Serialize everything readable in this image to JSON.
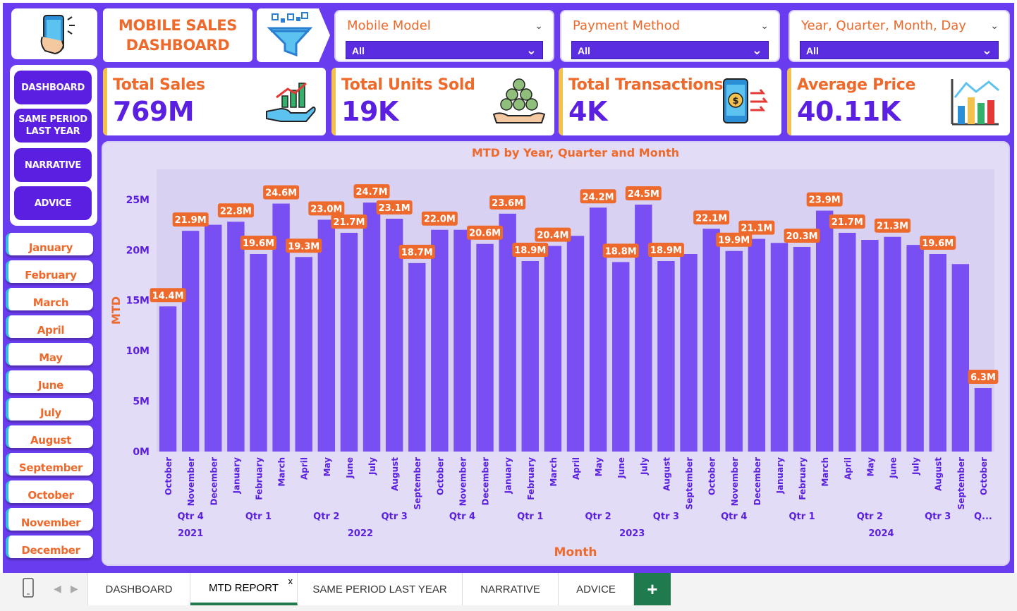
{
  "title": "MOBILE SALES DASHBOARD",
  "title_line1": "MOBILE SALES",
  "title_line2": "DASHBOARD",
  "slicers": [
    {
      "label": "Mobile Model",
      "value": "All"
    },
    {
      "label": "Payment Method",
      "value": "All"
    },
    {
      "label": "Year, Quarter, Month, Day",
      "value": "All"
    }
  ],
  "kpis": [
    {
      "label": "Total Sales",
      "value": "769M",
      "icon": "money-growth-icon"
    },
    {
      "label": "Total Units Sold",
      "value": "19K",
      "icon": "coins-stack-icon"
    },
    {
      "label": "Total Transactions",
      "value": "4K",
      "icon": "phone-payment-icon"
    },
    {
      "label": "Average Price",
      "value": "40.11K",
      "icon": "bar-chart-icon"
    }
  ],
  "nav": {
    "dashboard": "DASHBOARD",
    "same_period_1": "SAME PERIOD",
    "same_period_2": "LAST YEAR",
    "narrative": "NARRATIVE",
    "advice": "ADVICE"
  },
  "months": [
    "January",
    "February",
    "March",
    "April",
    "May",
    "June",
    "July",
    "August",
    "September",
    "October",
    "November",
    "December"
  ],
  "tabs": {
    "dashboard": "DASHBOARD",
    "mtd": "MTD REPORT",
    "mtd_close": "x",
    "same_period": "SAME PERIOD LAST YEAR",
    "narrative": "NARRATIVE",
    "advice": "ADVICE",
    "add": "+"
  },
  "colors": {
    "accent": "#6a3cf0",
    "orange": "#ee6a2c",
    "bar": "#6b3cf2",
    "kpi_value": "#5a1fe0"
  },
  "chart_data": {
    "type": "bar",
    "title": "MTD by Year, Quarter and Month",
    "xlabel": "Month",
    "ylabel": "MTD",
    "ylim": [
      0,
      28
    ],
    "y_unit": "M",
    "yticks": [
      "0M",
      "5M",
      "10M",
      "15M",
      "20M",
      "25M"
    ],
    "categories": [
      "October",
      "November",
      "December",
      "January",
      "February",
      "March",
      "April",
      "May",
      "June",
      "July",
      "August",
      "September",
      "October",
      "November",
      "December",
      "January",
      "February",
      "March",
      "April",
      "May",
      "June",
      "July",
      "August",
      "September",
      "October",
      "November",
      "December",
      "January",
      "February",
      "March",
      "April",
      "May",
      "June",
      "July",
      "August",
      "September",
      "October"
    ],
    "values": [
      14.4,
      21.9,
      22.5,
      22.8,
      19.6,
      24.6,
      19.3,
      23.0,
      21.7,
      24.7,
      23.1,
      18.7,
      22.0,
      22.0,
      20.6,
      23.6,
      18.9,
      20.4,
      21.4,
      24.2,
      18.8,
      24.5,
      18.9,
      19.6,
      22.1,
      19.9,
      21.1,
      20.7,
      20.3,
      23.9,
      21.7,
      21.0,
      21.3,
      20.5,
      19.6,
      18.6,
      6.3
    ],
    "labels": [
      "14.4M",
      "21.9M",
      "",
      "22.8M",
      "19.6M",
      "24.6M",
      "19.3M",
      "23.0M",
      "21.7M",
      "24.7M",
      "23.1M",
      "18.7M",
      "22.0M",
      "",
      "20.6M",
      "23.6M",
      "18.9M",
      "20.4M",
      "",
      "24.2M",
      "18.8M",
      "24.5M",
      "18.9M",
      "",
      "22.1M",
      "19.9M",
      "21.1M",
      "",
      "20.3M",
      "23.9M",
      "21.7M",
      "",
      "21.3M",
      "",
      "19.6M",
      "",
      "6.3M"
    ],
    "quarters": [
      {
        "label": "Qtr 4",
        "start": 0,
        "end": 2
      },
      {
        "label": "Qtr 1",
        "start": 3,
        "end": 5
      },
      {
        "label": "Qtr 2",
        "start": 6,
        "end": 8
      },
      {
        "label": "Qtr 3",
        "start": 9,
        "end": 11
      },
      {
        "label": "Qtr 4",
        "start": 12,
        "end": 14
      },
      {
        "label": "Qtr 1",
        "start": 15,
        "end": 17
      },
      {
        "label": "Qtr 2",
        "start": 18,
        "end": 20
      },
      {
        "label": "Qtr 3",
        "start": 21,
        "end": 23
      },
      {
        "label": "Qtr 4",
        "start": 24,
        "end": 26
      },
      {
        "label": "Qtr 1",
        "start": 27,
        "end": 29
      },
      {
        "label": "Qtr 2",
        "start": 30,
        "end": 32
      },
      {
        "label": "Qtr 3",
        "start": 33,
        "end": 35
      },
      {
        "label": "Q...",
        "start": 36,
        "end": 36
      }
    ],
    "years": [
      {
        "label": "2021",
        "start": 0,
        "end": 2
      },
      {
        "label": "2022",
        "start": 3,
        "end": 14
      },
      {
        "label": "2023",
        "start": 15,
        "end": 26
      },
      {
        "label": "2024",
        "start": 27,
        "end": 36
      }
    ]
  }
}
